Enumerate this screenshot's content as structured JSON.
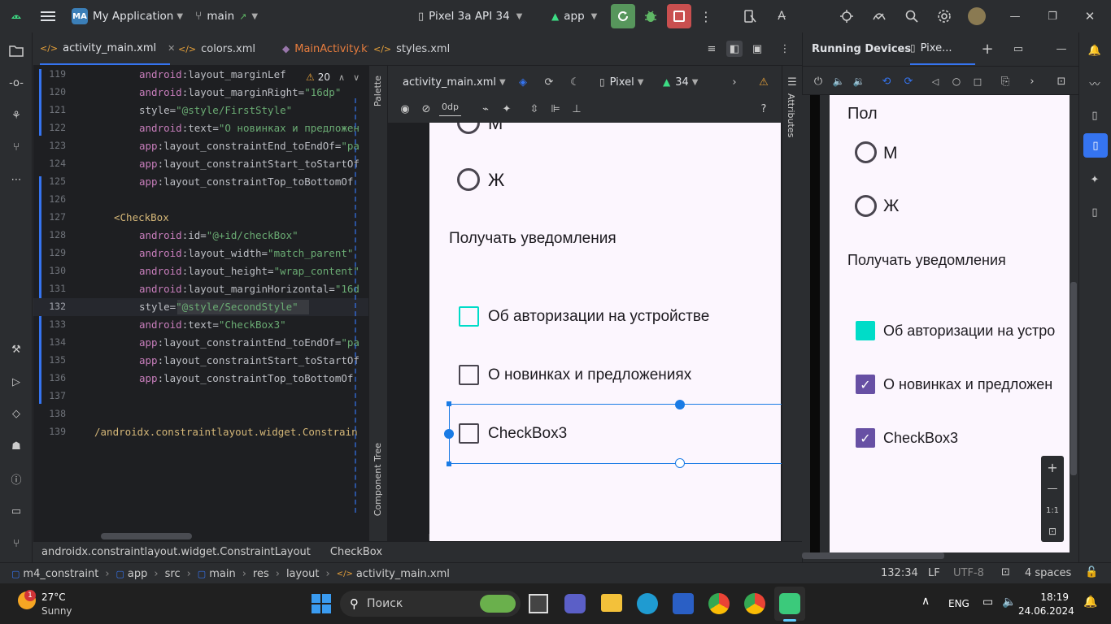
{
  "titlebar": {
    "app_badge": "MA",
    "project": "My Application",
    "branch": "main",
    "device": "Pixel 3a API 34",
    "run_config": "app"
  },
  "editor_tabs": [
    "activity_main.xml",
    "colors.xml",
    "MainActivity.kt",
    "styles.xml"
  ],
  "code": {
    "warning_count": "20",
    "lines": [
      {
        "n": "119",
        "parts": [
          [
            "ns",
            "android"
          ],
          [
            "at",
            ":layout_marginLef"
          ]
        ]
      },
      {
        "n": "120",
        "parts": [
          [
            "ns",
            "android"
          ],
          [
            "at",
            ":layout_marginRight="
          ],
          [
            "st",
            "\"16dp\""
          ]
        ]
      },
      {
        "n": "121",
        "parts": [
          [
            "at",
            "style="
          ],
          [
            "st",
            "\"@style/FirstStyle\""
          ]
        ]
      },
      {
        "n": "122",
        "parts": [
          [
            "ns",
            "android"
          ],
          [
            "at",
            ":text="
          ],
          [
            "st",
            "\"О новинках и предложен"
          ]
        ]
      },
      {
        "n": "123",
        "parts": [
          [
            "ns",
            "app"
          ],
          [
            "at",
            ":layout_constraintEnd_toEndOf="
          ],
          [
            "st",
            "\"pa"
          ]
        ]
      },
      {
        "n": "124",
        "parts": [
          [
            "ns",
            "app"
          ],
          [
            "at",
            ":layout_constraintStart_toStartOf"
          ]
        ]
      },
      {
        "n": "125",
        "parts": [
          [
            "ns",
            "app"
          ],
          [
            "at",
            ":layout_constraintTop_toBottomOf"
          ]
        ]
      },
      {
        "n": "126",
        "parts": []
      },
      {
        "n": "127",
        "parts": [
          [
            "tg",
            "<CheckBox"
          ]
        ]
      },
      {
        "n": "128",
        "parts": [
          [
            "ns",
            "android"
          ],
          [
            "at",
            ":id="
          ],
          [
            "st",
            "\"@+id/checkBox\""
          ]
        ]
      },
      {
        "n": "129",
        "parts": [
          [
            "ns",
            "android"
          ],
          [
            "at",
            ":layout_width="
          ],
          [
            "st",
            "\"match_parent\""
          ]
        ]
      },
      {
        "n": "130",
        "parts": [
          [
            "ns",
            "android"
          ],
          [
            "at",
            ":layout_height="
          ],
          [
            "st",
            "\"wrap_content\""
          ]
        ]
      },
      {
        "n": "131",
        "parts": [
          [
            "ns",
            "android"
          ],
          [
            "at",
            ":layout_marginHorizontal="
          ],
          [
            "st",
            "\"16d"
          ]
        ]
      },
      {
        "n": "132",
        "parts": [
          [
            "at",
            "style="
          ],
          [
            "st",
            "\"@style/SecondStyle\""
          ]
        ]
      },
      {
        "n": "133",
        "parts": [
          [
            "ns",
            "android"
          ],
          [
            "at",
            ":text="
          ],
          [
            "st",
            "\"CheckBox3\""
          ]
        ]
      },
      {
        "n": "134",
        "parts": [
          [
            "ns",
            "app"
          ],
          [
            "at",
            ":layout_constraintEnd_toEndOf="
          ],
          [
            "st",
            "\"pa"
          ]
        ]
      },
      {
        "n": "135",
        "parts": [
          [
            "ns",
            "app"
          ],
          [
            "at",
            ":layout_constraintStart_toStartOf"
          ]
        ]
      },
      {
        "n": "136",
        "parts": [
          [
            "ns",
            "app"
          ],
          [
            "at",
            ":layout_constraintTop_toBottomOf"
          ]
        ]
      },
      {
        "n": "137",
        "parts": []
      },
      {
        "n": "138",
        "parts": []
      },
      {
        "n": "139",
        "parts": [
          [
            "tg",
            "/androidx.constraintlayout.widget.Constrain"
          ]
        ]
      }
    ]
  },
  "side_panels": {
    "palette": "Palette",
    "component_tree": "Component Tree",
    "attributes": "Attributes"
  },
  "design_toolbar": {
    "file": "activity_main.xml",
    "device": "Pixel",
    "api": "34",
    "margin": "0dp"
  },
  "design_preview": {
    "radio_m": "М",
    "radio_f": "Ж",
    "notifications_label": "Получать уведомления",
    "checkbox1": "Об авторизации на устройстве",
    "checkbox2": "О новинках и предложениях",
    "checkbox3": "CheckBox3"
  },
  "running_devices": {
    "title": "Running Devices",
    "tab": "Pixe...",
    "zoom_ratio": "1:1"
  },
  "emulator": {
    "gender_label": "Пол",
    "radio_m": "М",
    "radio_f": "Ж",
    "notifications_label": "Получать уведомления",
    "checkbox1": "Об авторизации на устро",
    "checkbox2": "О новинках и предложен",
    "checkbox3": "CheckBox3"
  },
  "breadcrumb_component": [
    "androidx.constraintlayout.widget.ConstraintLayout",
    "CheckBox"
  ],
  "statusbar": {
    "path": [
      "m4_constraint",
      "app",
      "src",
      "main",
      "res",
      "layout",
      "activity_main.xml"
    ],
    "position": "132:34",
    "line_sep": "LF",
    "encoding": "UTF-8",
    "indent": "4 spaces"
  },
  "taskbar": {
    "weather_badge": "1",
    "temp": "27°C",
    "weather": "Sunny",
    "search": "Поиск",
    "lang": "ENG",
    "time": "18:19",
    "date": "24.06.2024"
  },
  "colors": {
    "accent": "#3574f0",
    "teal": "#00dcc8",
    "checked": "#6750a4"
  }
}
